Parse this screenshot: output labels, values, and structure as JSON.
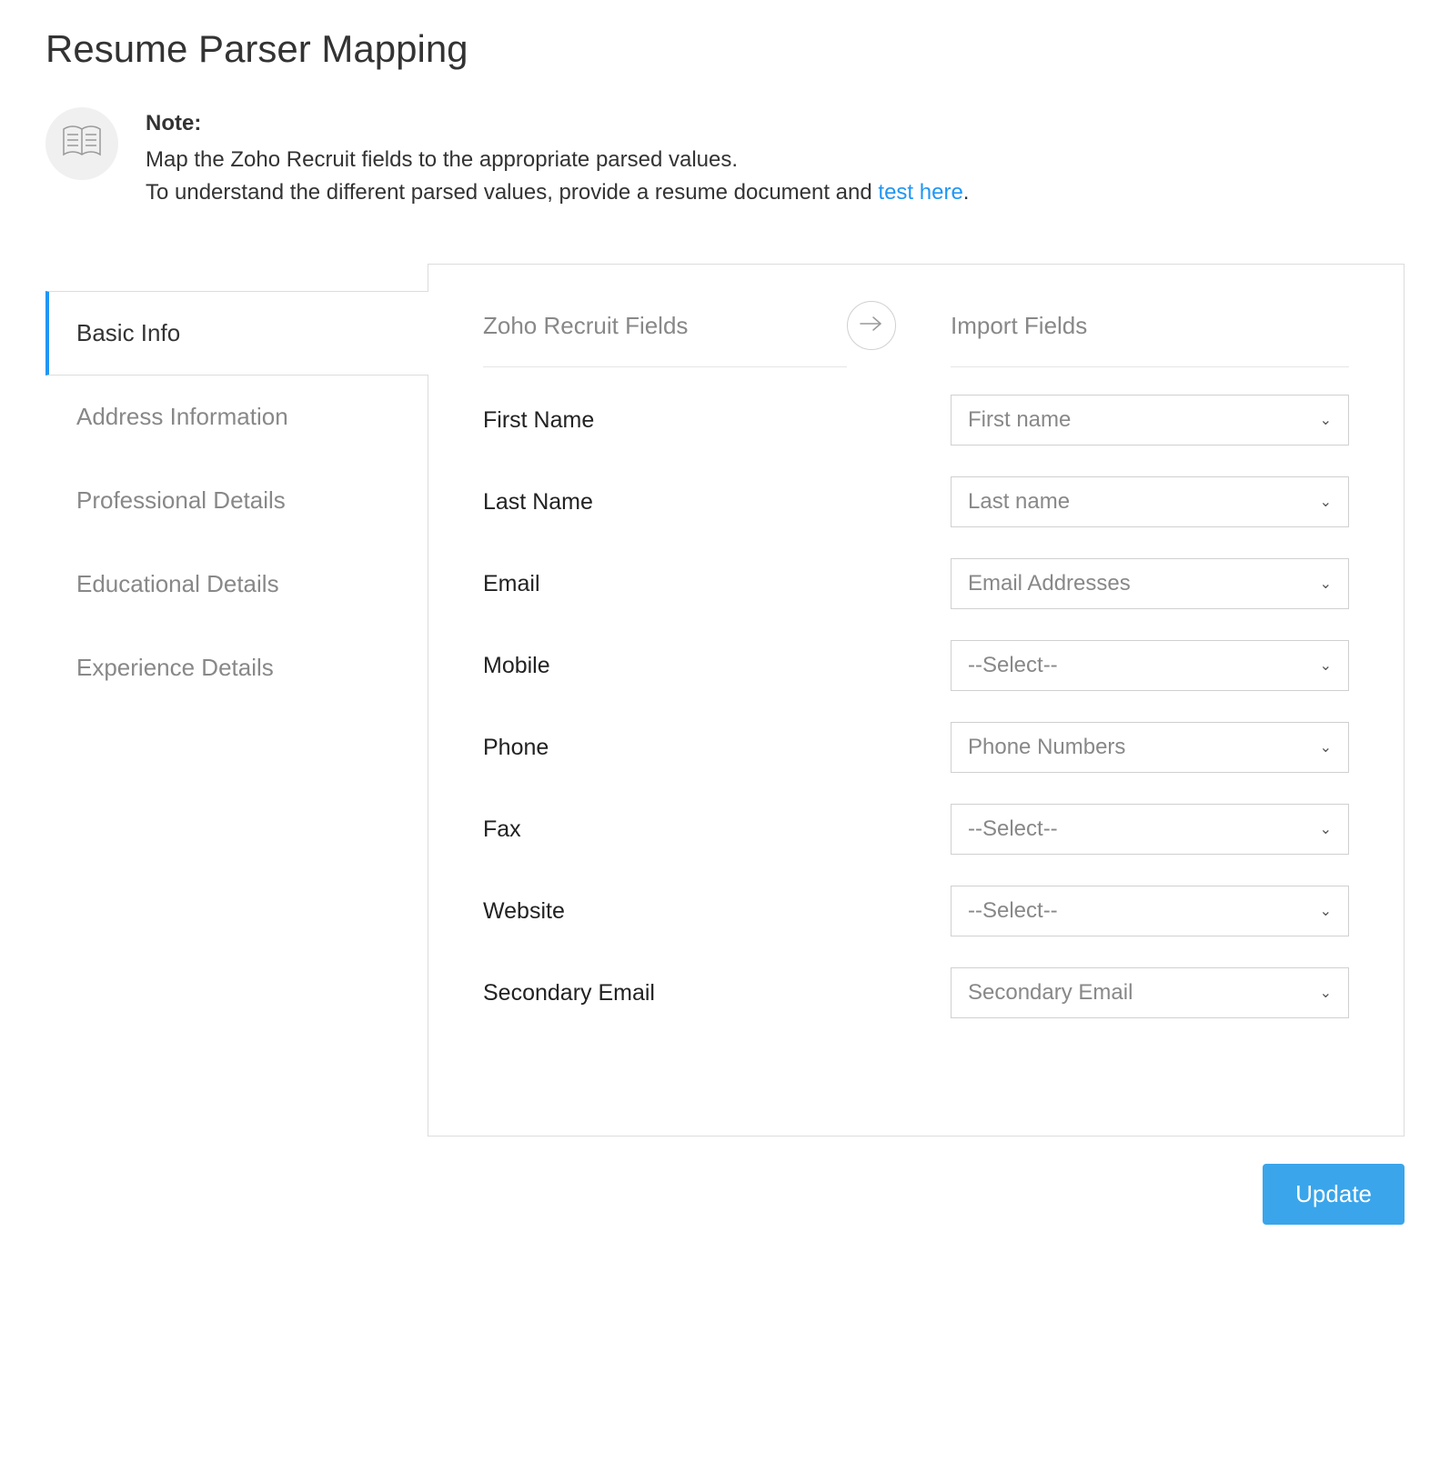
{
  "page_title": "Resume Parser Mapping",
  "note": {
    "label": "Note:",
    "line1": "Map the Zoho Recruit fields to the appropriate parsed values.",
    "line2_prefix": "To understand the different parsed values, provide a resume document and ",
    "link_text": "test here",
    "line2_suffix": "."
  },
  "tabs": [
    {
      "label": "Basic Info",
      "active": true
    },
    {
      "label": "Address Information",
      "active": false
    },
    {
      "label": "Professional Details",
      "active": false
    },
    {
      "label": "Educational Details",
      "active": false
    },
    {
      "label": "Experience Details",
      "active": false
    }
  ],
  "columns": {
    "left": "Zoho Recruit Fields",
    "right": "Import Fields"
  },
  "fields": [
    {
      "label": "First Name",
      "value": "First name"
    },
    {
      "label": "Last Name",
      "value": "Last name"
    },
    {
      "label": "Email",
      "value": "Email Addresses"
    },
    {
      "label": "Mobile",
      "value": "--Select--"
    },
    {
      "label": "Phone",
      "value": "Phone Numbers"
    },
    {
      "label": "Fax",
      "value": "--Select--"
    },
    {
      "label": "Website",
      "value": "--Select--"
    },
    {
      "label": "Secondary Email",
      "value": "Secondary Email"
    }
  ],
  "buttons": {
    "update": "Update"
  }
}
